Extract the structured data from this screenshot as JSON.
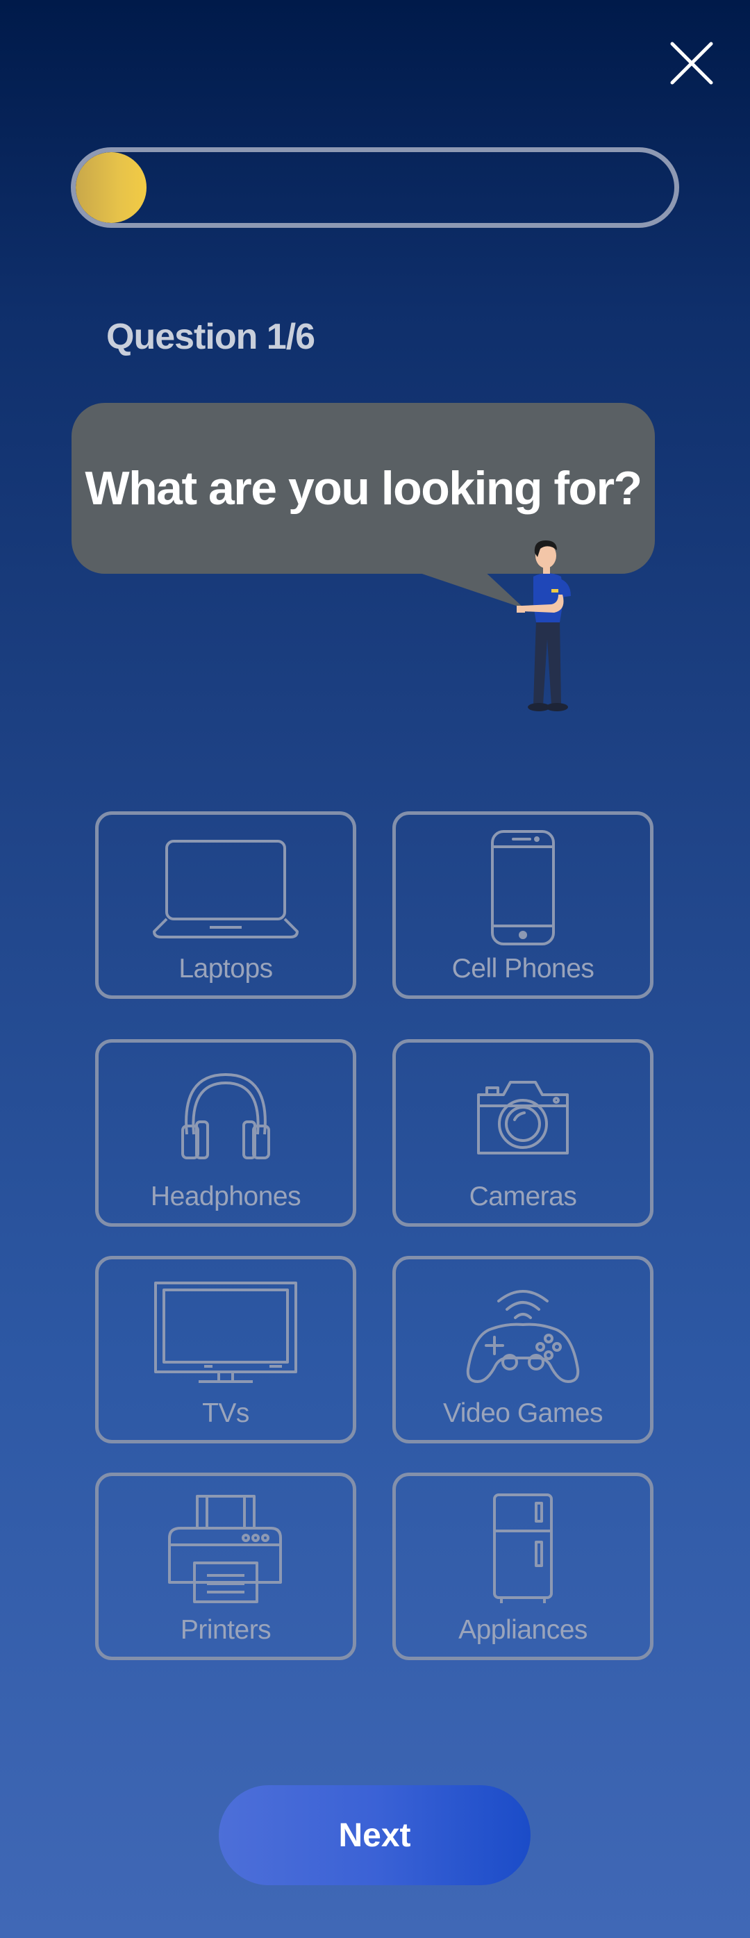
{
  "header": {
    "close_icon": "close-icon"
  },
  "progress": {
    "current": 1,
    "total": 6,
    "fraction": 0.117,
    "fill_color": "#e6c24a"
  },
  "question": {
    "label": "Question 1/6",
    "text": "What are you looking for?"
  },
  "options": [
    {
      "label": "Laptops",
      "icon": "laptop-icon"
    },
    {
      "label": "Cell Phones",
      "icon": "phone-icon"
    },
    {
      "label": "Headphones",
      "icon": "headphones-icon"
    },
    {
      "label": "Cameras",
      "icon": "camera-icon"
    },
    {
      "label": "TVs",
      "icon": "tv-icon"
    },
    {
      "label": "Video Games",
      "icon": "gamepad-icon"
    },
    {
      "label": "Printers",
      "icon": "printer-icon"
    },
    {
      "label": "Appliances",
      "icon": "fridge-icon"
    }
  ],
  "footer": {
    "next_label": "Next"
  },
  "colors": {
    "accent": "#e6c24a",
    "button": "#3b62d6",
    "tile_border": "#8390ab",
    "bubble": "#5a6064"
  }
}
